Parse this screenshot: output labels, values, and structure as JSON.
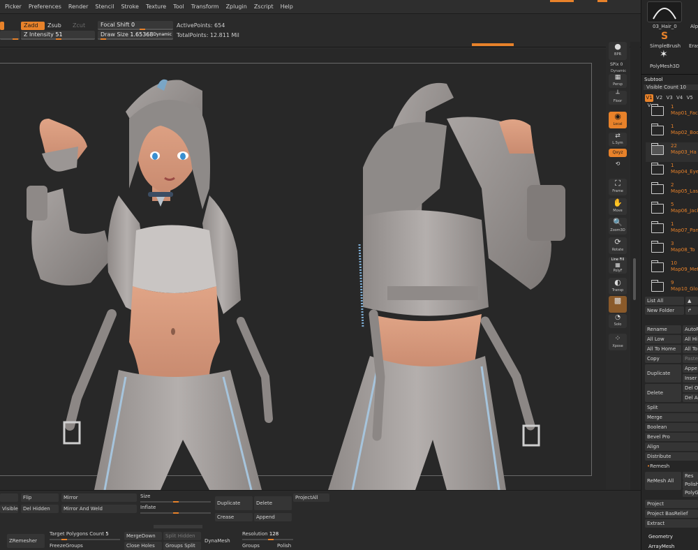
{
  "menu": [
    "Picker",
    "Preferences",
    "Render",
    "Stencil",
    "Stroke",
    "Texture",
    "Tool",
    "Transform",
    "Zplugin",
    "Zscript",
    "Help"
  ],
  "toolbar": {
    "zadd": "Zadd",
    "zsub": "Zsub",
    "zcut": "Zcut",
    "z_intensity_label": "Z Intensity",
    "z_intensity_value": "51",
    "focal_shift_label": "Focal Shift",
    "focal_shift_value": "0",
    "draw_size_label": "Draw Size",
    "draw_size_value": "1.65368",
    "dynamic": "Dynamic",
    "active_points": "ActivePoints: 654",
    "total_points": "TotalPoints: 12.811 Mil"
  },
  "viewport_tools": {
    "bpr": "BPR",
    "spix_label": "SPix",
    "spix_value": "0",
    "dynamic": "Dynamic",
    "persp": "Persp",
    "floor": "Floor",
    "local": "Local",
    "lsym": "L.Sym",
    "qxyz": "Qxyz",
    "frame": "Frame",
    "move": "Move",
    "zoom3d": "Zoom3D",
    "rotate": "Rotate",
    "linefill": "Line Fill",
    "polyf": "PolyF",
    "transp": "Transp",
    "solo": "Solo",
    "xpose": "Xpose"
  },
  "right_panel": {
    "hair_tool": "03_Hair_0",
    "alpha": "Alp",
    "simple_brush": "SimpleBrush",
    "eraser": "Eras",
    "polymesh": "PolyMesh3D",
    "subtool_title": "Subtool",
    "visible_count": "Visible Count 10",
    "v_tabs": [
      "V1",
      "V2",
      "V3",
      "V4",
      "V5",
      "V"
    ],
    "subtools": [
      {
        "count": "1",
        "name": "Map01_Fac"
      },
      {
        "count": "1",
        "name": "Map02_Bod"
      },
      {
        "count": "22",
        "name": "Map03_Ha"
      },
      {
        "count": "1",
        "name": "Map04_Eye"
      },
      {
        "count": "2",
        "name": "Map05_Lash"
      },
      {
        "count": "5",
        "name": "Map06_Jack"
      },
      {
        "count": "1",
        "name": "Map07_Pan"
      },
      {
        "count": "3",
        "name": "Map08_To"
      },
      {
        "count": "10",
        "name": "Map09_Metal"
      },
      {
        "count": "9",
        "name": "Map10_Glov"
      }
    ],
    "list_all": "List All",
    "new_folder": "New Folder",
    "rename": "Rename",
    "auto_r": "AutoR",
    "all_low": "All Low",
    "all_hi": "All Hi",
    "all_to_home": "All To Home",
    "all_to": "All To",
    "copy": "Copy",
    "paste": "Paste",
    "duplicate": "Duplicate",
    "append": "Appe",
    "insert": "Inser",
    "delete": "Delete",
    "del_other": "Del O",
    "del_all": "Del A",
    "split": "Split",
    "merge": "Merge",
    "boolean": "Boolean",
    "bevel_pro": "Bevel Pro",
    "align": "Align",
    "distribute": "Distribute",
    "remesh": "Remesh",
    "remesh_all": "ReMesh All",
    "res": "Res",
    "polish": "Polish",
    "polyg": "PolyG",
    "project": "Project",
    "project_basrelief": "Project BasRelief",
    "extract": "Extract",
    "geometry": "Geometry",
    "arraymesh": "ArrayMesh"
  },
  "bottom": {
    "flip": "Flip",
    "mirror": "Mirror",
    "visible": "Visible",
    "del_hidden": "Del Hidden",
    "mirror_and_weld": "Mirror And Weld",
    "size": "Size",
    "inflate": "Inflate",
    "duplicate": "Duplicate",
    "delete": "Delete",
    "project_all": "ProjectAll",
    "crease": "Crease",
    "append": "Append",
    "zremesher": "ZRemesher",
    "target_polygons_label": "Target Polygons Count",
    "target_polygons_value": "5",
    "freeze_groups": "FreezeGroups",
    "merge_down": "MergeDown",
    "split_hidden": "Split Hidden",
    "close_holes": "Close Holes",
    "groups_split": "Groups Split",
    "dynamesh": "DynaMesh",
    "resolution_label": "Resolution",
    "resolution_value": "128",
    "groups": "Groups",
    "polish": "Polish"
  }
}
